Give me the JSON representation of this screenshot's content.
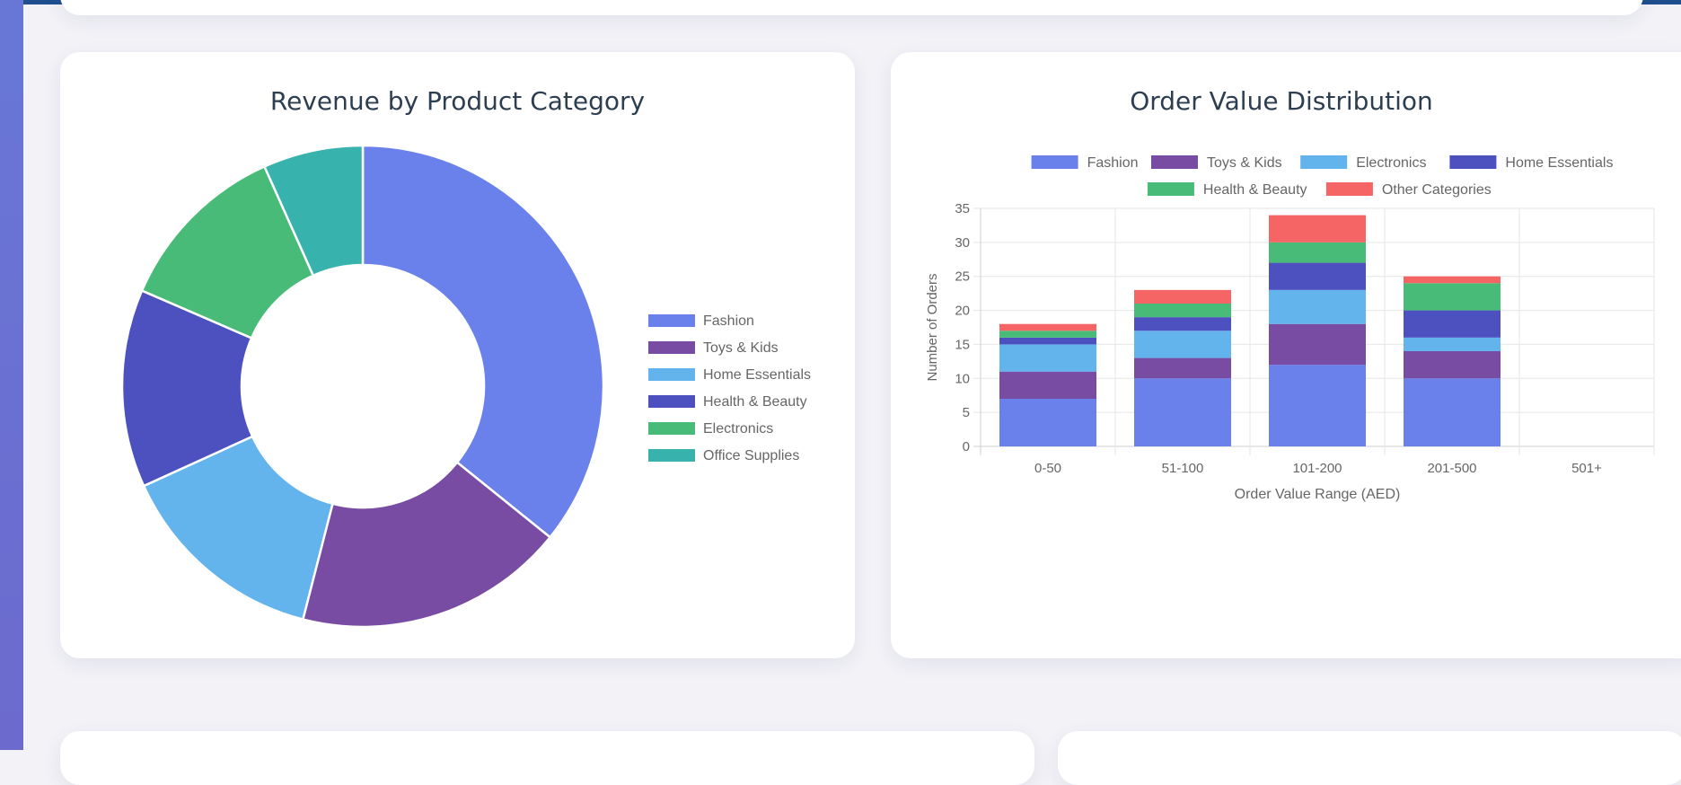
{
  "palette": {
    "fashion": "#6a80ea",
    "toys_kids": "#784ca3",
    "light_blue": "#63b3ed",
    "dark_indigo": "#4c51bf",
    "green": "#48bb78",
    "teal": "#38b2ac",
    "red": "#f56565"
  },
  "chart_data": [
    {
      "type": "pie",
      "variant": "doughnut",
      "title": "Revenue by Product Category",
      "legend_position": "right",
      "labels": [
        "Fashion",
        "Toys & Kids",
        "Home Essentials",
        "Health & Beauty",
        "Electronics",
        "Office Supplies"
      ],
      "values": [
        35.8,
        18.2,
        14.2,
        13.3,
        11.8,
        6.7
      ],
      "colors": [
        "#6a80ea",
        "#784ca3",
        "#63b3ed",
        "#4c51bf",
        "#48bb78",
        "#38b2ac"
      ]
    },
    {
      "type": "bar",
      "stacked": true,
      "title": "Order Value Distribution",
      "legend_position": "top",
      "categories": [
        "0-50",
        "51-100",
        "101-200",
        "201-500",
        "501+"
      ],
      "xlabel": "Order Value Range (AED)",
      "ylabel": "Number of Orders",
      "ylim": [
        0,
        35
      ],
      "yticks": [
        0,
        5,
        10,
        15,
        20,
        25,
        30,
        35
      ],
      "grid": true,
      "series": [
        {
          "name": "Fashion",
          "color": "#6a80ea",
          "values": [
            7,
            10,
            12,
            10,
            0
          ]
        },
        {
          "name": "Toys & Kids",
          "color": "#784ca3",
          "values": [
            4,
            3,
            6,
            4,
            0
          ]
        },
        {
          "name": "Electronics",
          "color": "#63b3ed",
          "values": [
            4,
            4,
            5,
            2,
            0
          ]
        },
        {
          "name": "Home Essentials",
          "color": "#4c51bf",
          "values": [
            1,
            2,
            4,
            4,
            0
          ]
        },
        {
          "name": "Health & Beauty",
          "color": "#48bb78",
          "values": [
            1,
            2,
            3,
            4,
            0
          ]
        },
        {
          "name": "Other Categories",
          "color": "#f56565",
          "values": [
            1,
            2,
            4,
            1,
            0
          ]
        }
      ]
    }
  ]
}
